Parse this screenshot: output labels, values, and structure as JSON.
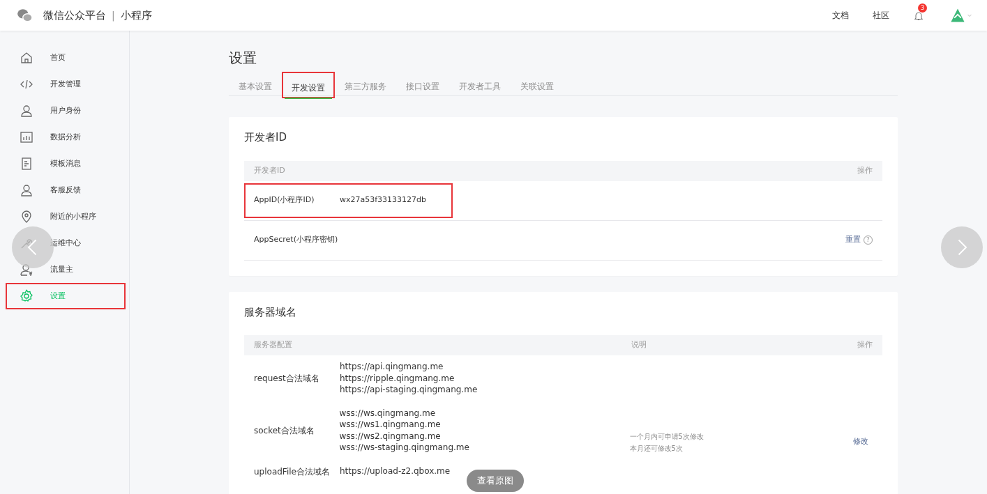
{
  "header": {
    "brand": "微信公众平台",
    "separator": "|",
    "product": "小程序",
    "links": [
      "文档",
      "社区"
    ],
    "notification_count": "3"
  },
  "sidebar": {
    "items": [
      {
        "label": "首页",
        "selected": false,
        "annotated": false
      },
      {
        "label": "开发管理",
        "selected": false,
        "annotated": false
      },
      {
        "label": "用户身份",
        "selected": false,
        "annotated": false
      },
      {
        "label": "数据分析",
        "selected": false,
        "annotated": false
      },
      {
        "label": "模板消息",
        "selected": false,
        "annotated": false
      },
      {
        "label": "客服反馈",
        "selected": false,
        "annotated": false
      },
      {
        "label": "附近的小程序",
        "selected": false,
        "annotated": false
      },
      {
        "label": "运维中心",
        "selected": false,
        "annotated": false
      },
      {
        "label": "流量主",
        "selected": false,
        "annotated": false
      },
      {
        "label": "设置",
        "selected": true,
        "annotated": true
      }
    ]
  },
  "page_title": "设置",
  "tabs": [
    {
      "label": "基本设置",
      "selected": false,
      "annotated": false
    },
    {
      "label": "开发设置",
      "selected": true,
      "annotated": true
    },
    {
      "label": "第三方服务",
      "selected": false,
      "annotated": false
    },
    {
      "label": "接口设置",
      "selected": false,
      "annotated": false
    },
    {
      "label": "开发者工具",
      "selected": false,
      "annotated": false
    },
    {
      "label": "关联设置",
      "selected": false,
      "annotated": false
    }
  ],
  "developer_id": {
    "title": "开发者ID",
    "columns": [
      "开发者ID",
      "操作"
    ],
    "rows": [
      {
        "label": "AppID(小程序ID)",
        "value": "wx27a53f33133127db",
        "annotated": true
      },
      {
        "label": "AppSecret(小程序密钥)",
        "action": "重置",
        "help": "?",
        "annotated": false
      }
    ]
  },
  "server_domains": {
    "title": "服务器域名",
    "columns": [
      "服务器配置",
      "说明",
      "操作"
    ],
    "rows": [
      {
        "label": "request合法域名",
        "domains": [
          "https://api.qingmang.me",
          "https://ripple.qingmang.me",
          "https://api-staging.qingmang.me"
        ]
      },
      {
        "label": "socket合法域名",
        "domains": [
          "wss://ws.qingmang.me",
          "wss://ws1.qingmang.me",
          "wss://ws2.qingmang.me",
          "wss://ws-staging.qingmang.me"
        ],
        "note": [
          "一个月内可申请5次修改",
          "本月还可修改5次"
        ],
        "action": "修改"
      },
      {
        "label": "uploadFile合法域名",
        "domains": [
          "https://upload-z2.qbox.me"
        ]
      }
    ]
  },
  "viewer": {
    "view_original": "查看原图"
  }
}
